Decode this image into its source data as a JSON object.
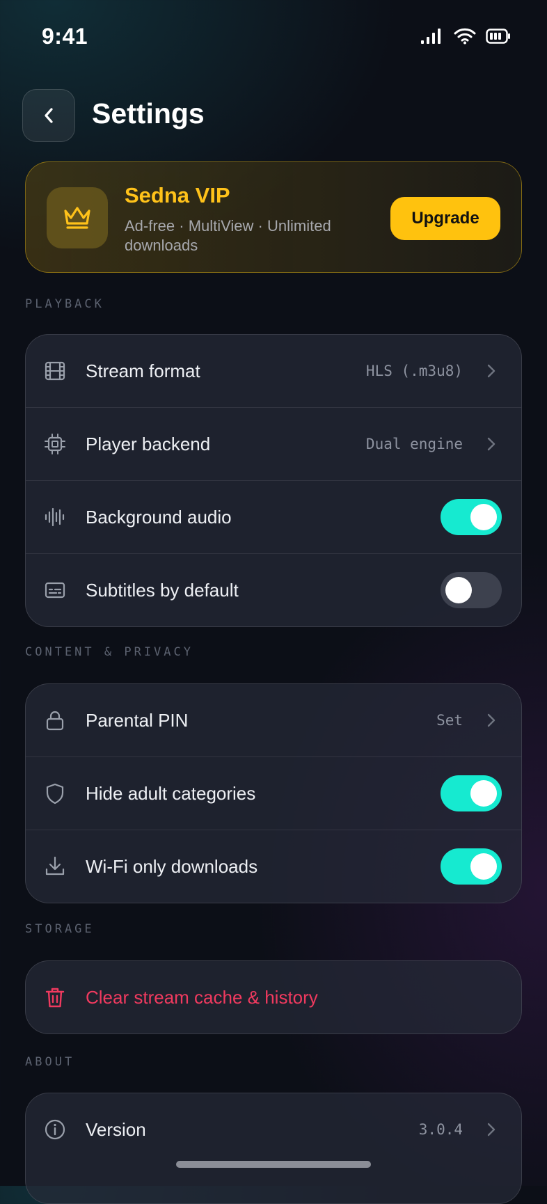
{
  "status": {
    "time": "9:41"
  },
  "header": {
    "title": "Settings"
  },
  "vip": {
    "title": "Sedna VIP",
    "subtitle": "Ad-free · MultiView · Unlimited downloads",
    "upgrade_label": "Upgrade",
    "accent_color": "#FFC20E"
  },
  "sections": {
    "playback": {
      "label": "PLAYBACK",
      "rows": [
        {
          "label": "Stream format",
          "value": "HLS (.m3u8)",
          "icon": "film-icon",
          "control": "chevron"
        },
        {
          "label": "Player backend",
          "value": "Dual engine",
          "icon": "cpu-chip-icon",
          "control": "chevron"
        },
        {
          "label": "Background audio",
          "icon": "audio-waveform-icon",
          "control": "toggle",
          "enabled": true
        },
        {
          "label": "Subtitles by default",
          "icon": "subtitles-icon",
          "control": "toggle",
          "enabled": false
        }
      ]
    },
    "content_privacy": {
      "label": "CONTENT & PRIVACY",
      "rows": [
        {
          "label": "Parental PIN",
          "value": "Set",
          "icon": "lock-icon",
          "control": "chevron"
        },
        {
          "label": "Hide adult categories",
          "icon": "shield-icon",
          "control": "toggle",
          "enabled": true
        },
        {
          "label": "Wi-Fi only downloads",
          "icon": "download-icon",
          "control": "toggle",
          "enabled": true
        }
      ]
    },
    "storage": {
      "label": "STORAGE",
      "rows": [
        {
          "label": "Clear stream cache & history",
          "icon": "trash-icon",
          "danger_color": "#F03A5F"
        }
      ]
    },
    "about": {
      "label": "ABOUT",
      "rows": [
        {
          "label": "Version",
          "value": "3.0.4",
          "icon": "info-icon",
          "control": "chevron"
        }
      ]
    }
  },
  "colors": {
    "toggle_on": "#16EAD0",
    "toggle_off": "#3D414E"
  }
}
